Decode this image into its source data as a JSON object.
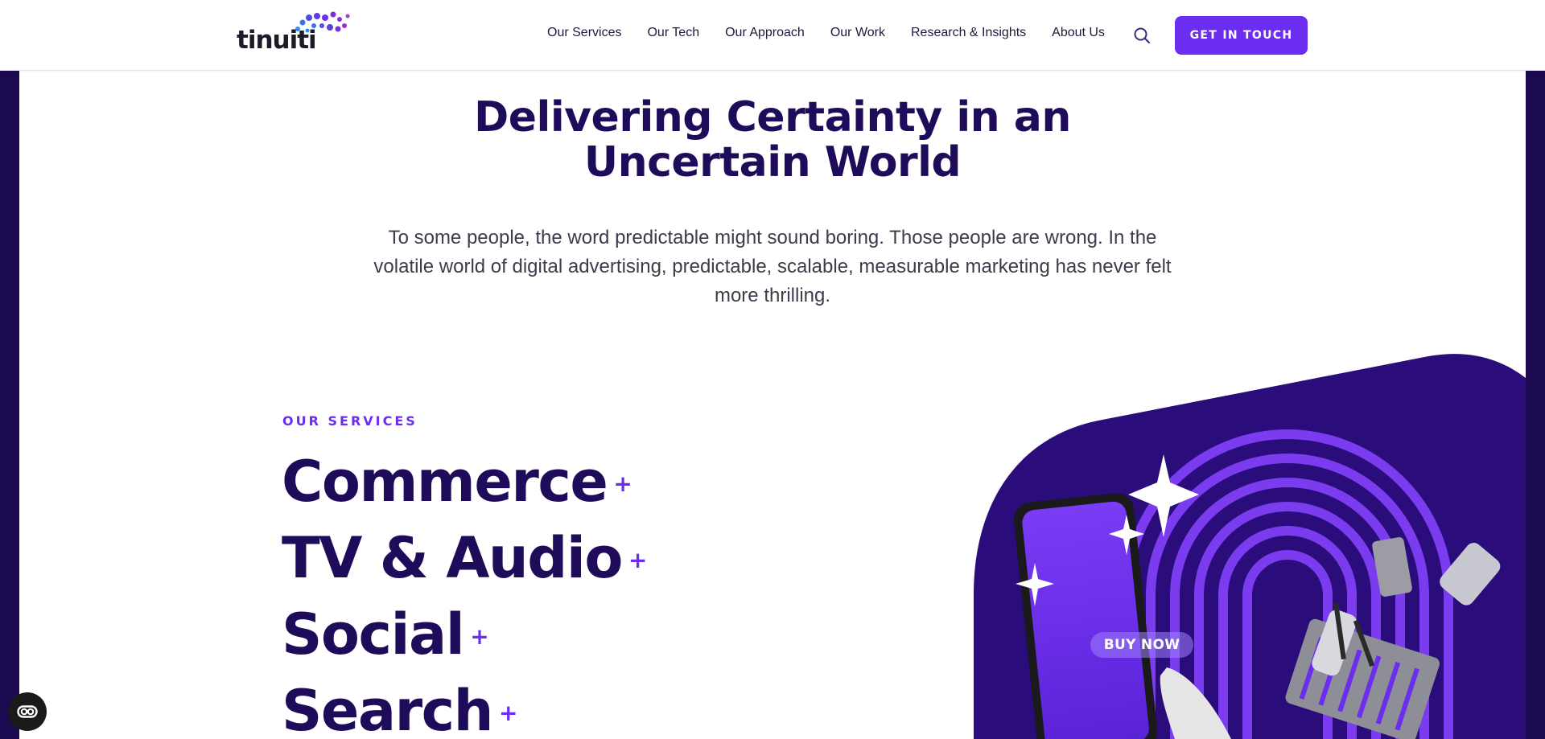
{
  "header": {
    "logo_text": "tinuiti",
    "nav": [
      "Our Services",
      "Our Tech",
      "Our Approach",
      "Our Work",
      "Research & Insights",
      "About Us"
    ],
    "cta_label": "GET IN TOUCH"
  },
  "hero": {
    "title": "Delivering Certainty in an Uncertain World",
    "subtitle": "To some people, the word predictable might sound boring. Those people are wrong. In the volatile world of digital advertising, predictable, scalable, measurable marketing has never felt more thrilling."
  },
  "services": {
    "eyebrow": "OUR SERVICES",
    "items": [
      {
        "label": "Commerce",
        "icon": "+"
      },
      {
        "label": "TV & Audio",
        "icon": "+"
      },
      {
        "label": "Social",
        "icon": "+"
      },
      {
        "label": "Search",
        "icon": "+"
      }
    ]
  },
  "illustration": {
    "button_text": "BUY NOW"
  },
  "colors": {
    "brand_purple": "#6b2ef0",
    "navy": "#1e0b5a",
    "frame": "#1c0a50"
  },
  "icons": {
    "search": "search-icon",
    "accessibility": "accessibility-icon"
  }
}
